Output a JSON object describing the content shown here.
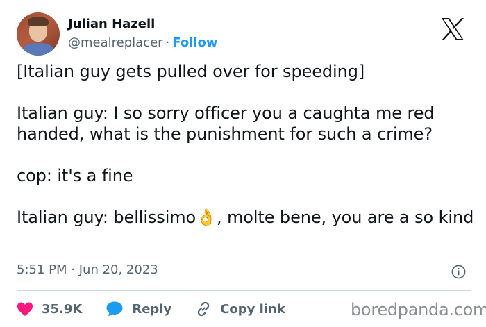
{
  "author": {
    "name": "Julian Hazell",
    "handle": "@mealreplacer",
    "separator": "·",
    "follow_label": "Follow"
  },
  "tweet": {
    "lines": [
      "[Italian guy gets pulled over for speeding]",
      "Italian guy: I so sorry officer you a caughta me red handed, what is the punishment for such a crime?",
      "cop: it's a fine",
      "Italian guy: bellissimo",
      ", molte bene, you are a so kind"
    ],
    "emoji": "👌"
  },
  "meta": {
    "time": "5:51 PM",
    "separator": "·",
    "date": "Jun 20, 2023"
  },
  "actions": {
    "likes": "35.9K",
    "reply_label": "Reply",
    "copy_label": "Copy link"
  },
  "watermark": "boredpanda.com",
  "colors": {
    "like": "#f91880",
    "link": "#1d9bf0",
    "muted": "#536471"
  },
  "icons": [
    "x-logo-icon",
    "info-icon",
    "heart-icon",
    "reply-bubble-icon",
    "link-icon"
  ]
}
